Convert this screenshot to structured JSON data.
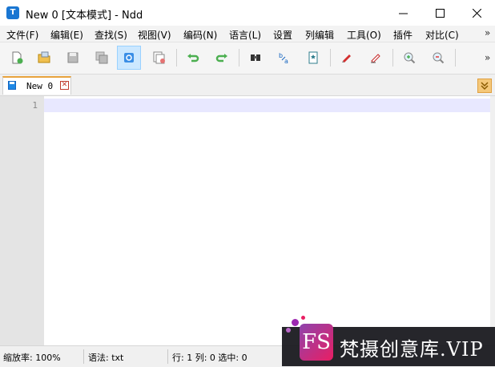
{
  "window": {
    "app_icon_letter": "T",
    "title": "New 0 [文本模式] - Ndd"
  },
  "menu": {
    "items": [
      "文件(F)",
      "编辑(E)",
      "查找(S)",
      "视图(V)",
      "编码(N)",
      "语言(L)",
      "设置",
      "列编辑",
      "工具(O)",
      "插件",
      "对比(C)"
    ],
    "more": "»"
  },
  "toolbar": {
    "buttons": [
      "new-file-icon",
      "open-folder-icon",
      "save-icon",
      "save-all-icon",
      "close-icon",
      "close-all-icon",
      "undo-icon",
      "redo-icon",
      "find-icon",
      "replace-icon",
      "bookmark-icon",
      "marker-icon",
      "eraser-icon",
      "zoom-in-icon",
      "zoom-out-icon"
    ],
    "active_button": "close-icon",
    "more": "»"
  },
  "tabs": [
    {
      "label": "New 0",
      "active": true
    }
  ],
  "editor": {
    "line_numbers": [
      "1"
    ],
    "current_line_color": "#e8e8ff"
  },
  "status": {
    "zoom": "缩放率: 100%",
    "syntax": "语法: txt",
    "position": "行: 1 列: 0 选中: 0"
  },
  "watermark": {
    "logo": "FS",
    "text": "梵摄创意库.VIP"
  },
  "colors": {
    "accent": "#1976d2",
    "tab_top": "#e8a33d",
    "active_tool_bg": "#cce8ff"
  }
}
